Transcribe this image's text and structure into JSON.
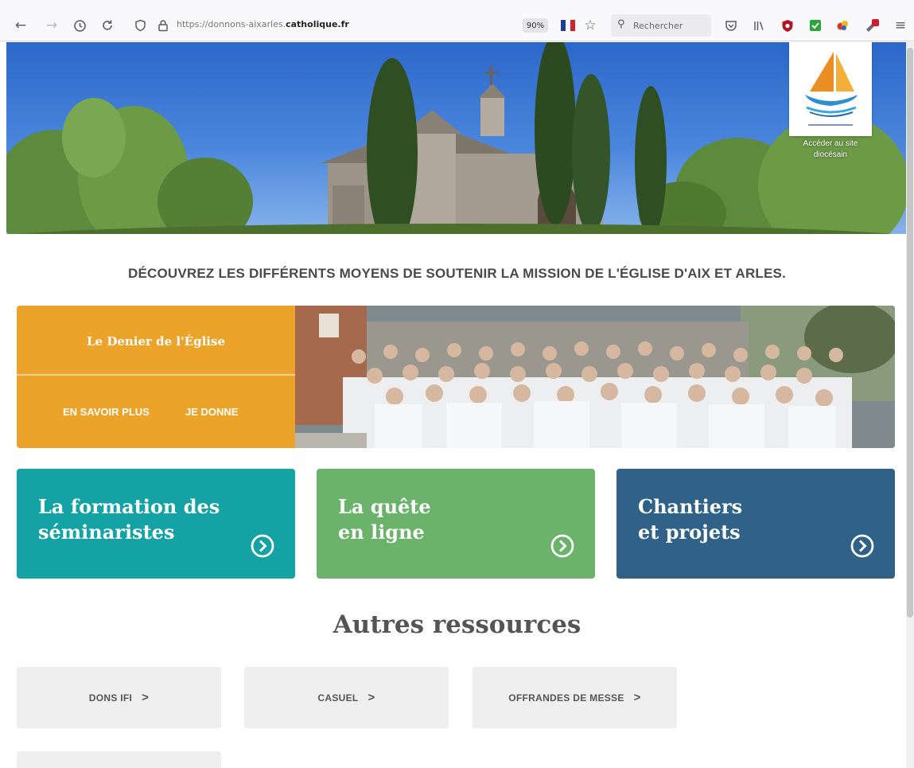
{
  "browser": {
    "url_prefix": "https://donnons-aixarles.",
    "url_domain": "catholique.fr",
    "zoom": "90%",
    "search_placeholder": "Rechercher"
  },
  "hero": {
    "logo_caption_line1": "Accéder au site",
    "logo_caption_line2": "diocésain"
  },
  "headline": "DÉCOUVREZ LES DIFFÉRENTS MOYENS DE SOUTENIR LA MISSION DE L'ÉGLISE D'AIX ET ARLES.",
  "denier": {
    "title": "Le Denier de l'Église",
    "learn_more": "EN SAVOIR PLUS",
    "donate": "JE DONNE",
    "color": "#eba32a"
  },
  "cards": [
    {
      "line1": "La formation des",
      "line2": "séminaristes",
      "color": "#15a2a4"
    },
    {
      "line1": "La quête",
      "line2": "en ligne",
      "color": "#6bb36b"
    },
    {
      "line1": "Chantiers",
      "line2": "et projets",
      "color": "#2f6189"
    }
  ],
  "resources": {
    "heading": "Autres ressources",
    "items": [
      {
        "label": "DONS IFI",
        "chevron": ">"
      },
      {
        "label": "CASUEL",
        "chevron": ">"
      },
      {
        "label": "OFFRANDES DE MESSE",
        "chevron": ">"
      }
    ]
  }
}
